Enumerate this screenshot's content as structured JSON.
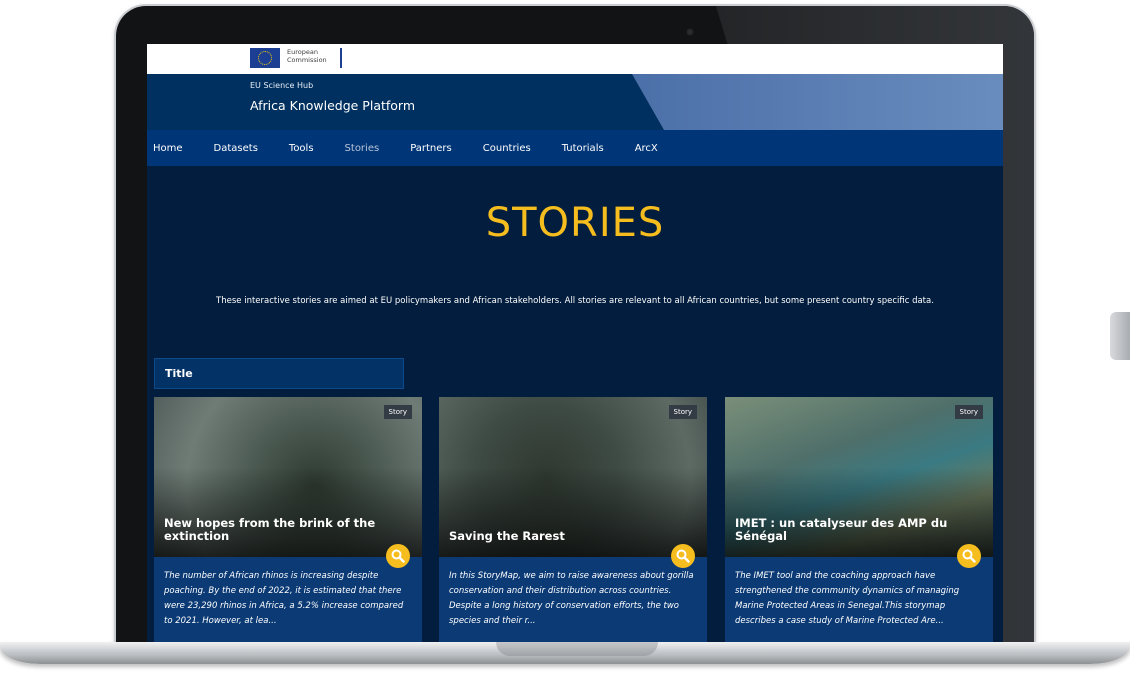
{
  "ec_logo": {
    "line1": "European",
    "line2": "Commission"
  },
  "header": {
    "subtitle": "EU Science Hub",
    "title": "Africa Knowledge Platform"
  },
  "nav": {
    "items": [
      {
        "label": "Home"
      },
      {
        "label": "Datasets"
      },
      {
        "label": "Tools"
      },
      {
        "label": "Stories",
        "active": true
      },
      {
        "label": "Partners"
      },
      {
        "label": "Countries"
      },
      {
        "label": "Tutorials"
      },
      {
        "label": "ArcX"
      }
    ]
  },
  "page": {
    "title": "STORIES",
    "intro": "These interactive stories are aimed at EU policymakers and African stakeholders. All stories are relevant to all African countries, but some present country specific data."
  },
  "filter": {
    "label": "Title"
  },
  "cards": [
    {
      "badge": "Story",
      "title": "New hopes from the brink of the extinction",
      "desc": "The number of African rhinos is increasing despite poaching. By the end of 2022, it is estimated that there were 23,290 rhinos in Africa, a 5.2% increase compared to 2021. However, at lea..."
    },
    {
      "badge": "Story",
      "title": "Saving the Rarest",
      "desc": "In this StoryMap, we aim to raise awareness about gorilla conservation and their distribution across countries. Despite a long history of conservation efforts, the two species and their r..."
    },
    {
      "badge": "Story",
      "title": "IMET : un catalyseur des AMP du Sénégal",
      "desc": "The IMET tool and the coaching approach have strengthened the community dynamics of managing Marine Protected Areas in Senegal.This storymap describes a case study of Marine Protected Are..."
    }
  ],
  "colors": {
    "accent": "#f6bd1e",
    "nav_bg": "#003677",
    "page_bg": "#021d3d",
    "card_body": "#0b3a75"
  }
}
